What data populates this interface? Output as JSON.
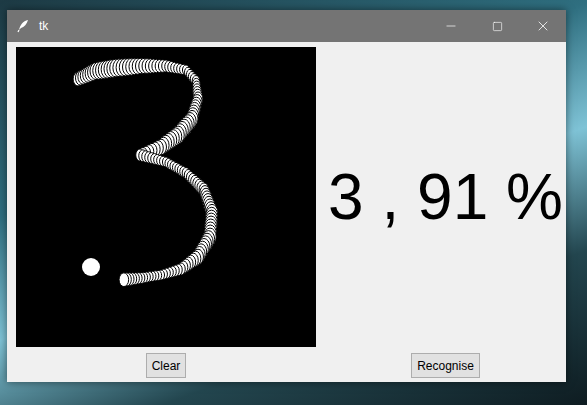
{
  "window": {
    "title": "tk"
  },
  "result": {
    "text": "3 , 91 %"
  },
  "buttons": [
    {
      "label": "Clear"
    },
    {
      "label": "Recognise"
    }
  ]
}
